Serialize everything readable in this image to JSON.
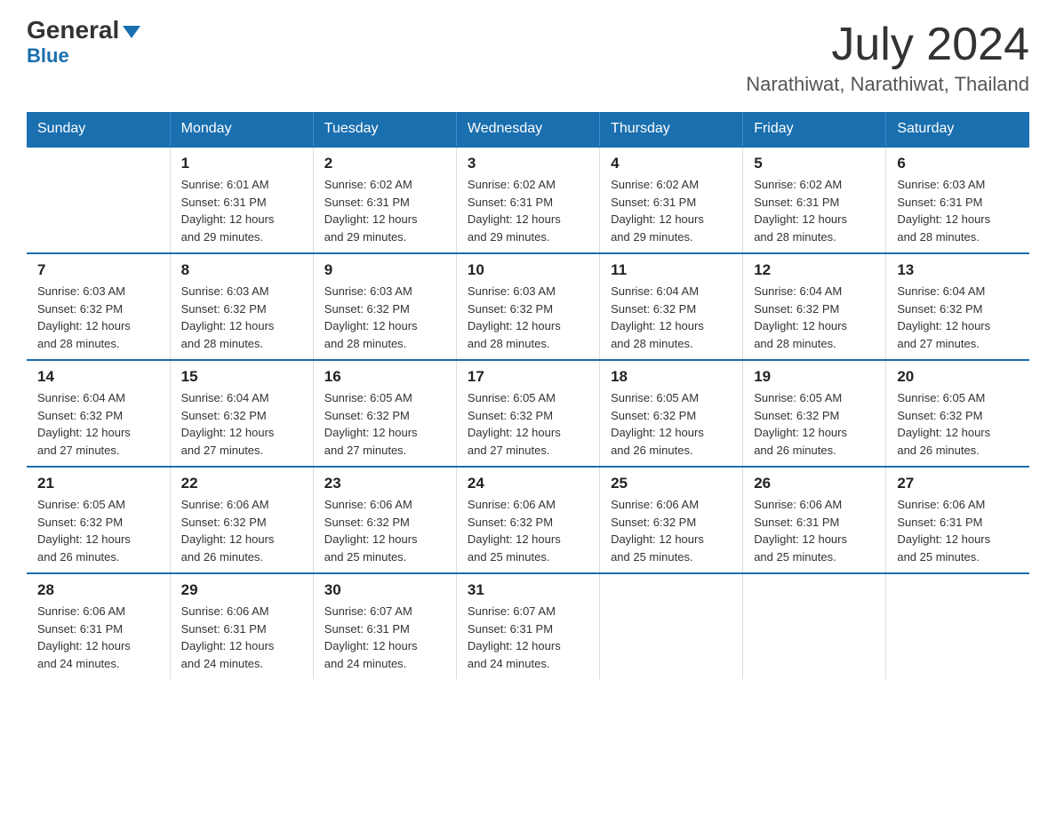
{
  "logo": {
    "general": "General",
    "triangle": "▼",
    "blue": "Blue"
  },
  "header": {
    "month_year": "July 2024",
    "location": "Narathiwat, Narathiwat, Thailand"
  },
  "weekdays": [
    "Sunday",
    "Monday",
    "Tuesday",
    "Wednesday",
    "Thursday",
    "Friday",
    "Saturday"
  ],
  "weeks": [
    [
      {
        "day": "",
        "info": ""
      },
      {
        "day": "1",
        "info": "Sunrise: 6:01 AM\nSunset: 6:31 PM\nDaylight: 12 hours\nand 29 minutes."
      },
      {
        "day": "2",
        "info": "Sunrise: 6:02 AM\nSunset: 6:31 PM\nDaylight: 12 hours\nand 29 minutes."
      },
      {
        "day": "3",
        "info": "Sunrise: 6:02 AM\nSunset: 6:31 PM\nDaylight: 12 hours\nand 29 minutes."
      },
      {
        "day": "4",
        "info": "Sunrise: 6:02 AM\nSunset: 6:31 PM\nDaylight: 12 hours\nand 29 minutes."
      },
      {
        "day": "5",
        "info": "Sunrise: 6:02 AM\nSunset: 6:31 PM\nDaylight: 12 hours\nand 28 minutes."
      },
      {
        "day": "6",
        "info": "Sunrise: 6:03 AM\nSunset: 6:31 PM\nDaylight: 12 hours\nand 28 minutes."
      }
    ],
    [
      {
        "day": "7",
        "info": "Sunrise: 6:03 AM\nSunset: 6:32 PM\nDaylight: 12 hours\nand 28 minutes."
      },
      {
        "day": "8",
        "info": "Sunrise: 6:03 AM\nSunset: 6:32 PM\nDaylight: 12 hours\nand 28 minutes."
      },
      {
        "day": "9",
        "info": "Sunrise: 6:03 AM\nSunset: 6:32 PM\nDaylight: 12 hours\nand 28 minutes."
      },
      {
        "day": "10",
        "info": "Sunrise: 6:03 AM\nSunset: 6:32 PM\nDaylight: 12 hours\nand 28 minutes."
      },
      {
        "day": "11",
        "info": "Sunrise: 6:04 AM\nSunset: 6:32 PM\nDaylight: 12 hours\nand 28 minutes."
      },
      {
        "day": "12",
        "info": "Sunrise: 6:04 AM\nSunset: 6:32 PM\nDaylight: 12 hours\nand 28 minutes."
      },
      {
        "day": "13",
        "info": "Sunrise: 6:04 AM\nSunset: 6:32 PM\nDaylight: 12 hours\nand 27 minutes."
      }
    ],
    [
      {
        "day": "14",
        "info": "Sunrise: 6:04 AM\nSunset: 6:32 PM\nDaylight: 12 hours\nand 27 minutes."
      },
      {
        "day": "15",
        "info": "Sunrise: 6:04 AM\nSunset: 6:32 PM\nDaylight: 12 hours\nand 27 minutes."
      },
      {
        "day": "16",
        "info": "Sunrise: 6:05 AM\nSunset: 6:32 PM\nDaylight: 12 hours\nand 27 minutes."
      },
      {
        "day": "17",
        "info": "Sunrise: 6:05 AM\nSunset: 6:32 PM\nDaylight: 12 hours\nand 27 minutes."
      },
      {
        "day": "18",
        "info": "Sunrise: 6:05 AM\nSunset: 6:32 PM\nDaylight: 12 hours\nand 26 minutes."
      },
      {
        "day": "19",
        "info": "Sunrise: 6:05 AM\nSunset: 6:32 PM\nDaylight: 12 hours\nand 26 minutes."
      },
      {
        "day": "20",
        "info": "Sunrise: 6:05 AM\nSunset: 6:32 PM\nDaylight: 12 hours\nand 26 minutes."
      }
    ],
    [
      {
        "day": "21",
        "info": "Sunrise: 6:05 AM\nSunset: 6:32 PM\nDaylight: 12 hours\nand 26 minutes."
      },
      {
        "day": "22",
        "info": "Sunrise: 6:06 AM\nSunset: 6:32 PM\nDaylight: 12 hours\nand 26 minutes."
      },
      {
        "day": "23",
        "info": "Sunrise: 6:06 AM\nSunset: 6:32 PM\nDaylight: 12 hours\nand 25 minutes."
      },
      {
        "day": "24",
        "info": "Sunrise: 6:06 AM\nSunset: 6:32 PM\nDaylight: 12 hours\nand 25 minutes."
      },
      {
        "day": "25",
        "info": "Sunrise: 6:06 AM\nSunset: 6:32 PM\nDaylight: 12 hours\nand 25 minutes."
      },
      {
        "day": "26",
        "info": "Sunrise: 6:06 AM\nSunset: 6:31 PM\nDaylight: 12 hours\nand 25 minutes."
      },
      {
        "day": "27",
        "info": "Sunrise: 6:06 AM\nSunset: 6:31 PM\nDaylight: 12 hours\nand 25 minutes."
      }
    ],
    [
      {
        "day": "28",
        "info": "Sunrise: 6:06 AM\nSunset: 6:31 PM\nDaylight: 12 hours\nand 24 minutes."
      },
      {
        "day": "29",
        "info": "Sunrise: 6:06 AM\nSunset: 6:31 PM\nDaylight: 12 hours\nand 24 minutes."
      },
      {
        "day": "30",
        "info": "Sunrise: 6:07 AM\nSunset: 6:31 PM\nDaylight: 12 hours\nand 24 minutes."
      },
      {
        "day": "31",
        "info": "Sunrise: 6:07 AM\nSunset: 6:31 PM\nDaylight: 12 hours\nand 24 minutes."
      },
      {
        "day": "",
        "info": ""
      },
      {
        "day": "",
        "info": ""
      },
      {
        "day": "",
        "info": ""
      }
    ]
  ]
}
